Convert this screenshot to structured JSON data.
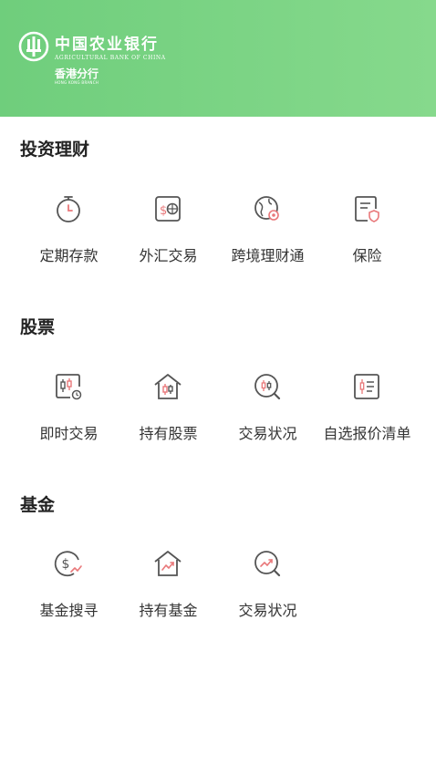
{
  "header": {
    "bank_name_cn": "中国农业银行",
    "bank_name_en": "AGRICULTURAL BANK OF CHINA",
    "branch_cn": "香港分行",
    "branch_en": "HONG KONG BRANCH"
  },
  "sections": [
    {
      "title": "投资理财",
      "items": [
        {
          "label": "定期存款",
          "icon": "timer-icon"
        },
        {
          "label": "外汇交易",
          "icon": "forex-icon"
        },
        {
          "label": "跨境理财通",
          "icon": "globe-icon"
        },
        {
          "label": "保险",
          "icon": "insurance-icon"
        }
      ]
    },
    {
      "title": "股票",
      "items": [
        {
          "label": "即时交易",
          "icon": "candlestick-chart-icon"
        },
        {
          "label": "持有股票",
          "icon": "house-candlestick-icon"
        },
        {
          "label": "交易状况",
          "icon": "search-candlestick-icon"
        },
        {
          "label": "自选报价清单",
          "icon": "quote-list-icon"
        }
      ]
    },
    {
      "title": "基金",
      "items": [
        {
          "label": "基金搜寻",
          "icon": "fund-search-icon"
        },
        {
          "label": "持有基金",
          "icon": "house-trend-icon"
        },
        {
          "label": "交易状况",
          "icon": "search-trend-icon"
        }
      ]
    }
  ],
  "colors": {
    "header_green": "#7fd685",
    "icon_gray": "#555555",
    "icon_accent": "#e9787a"
  }
}
